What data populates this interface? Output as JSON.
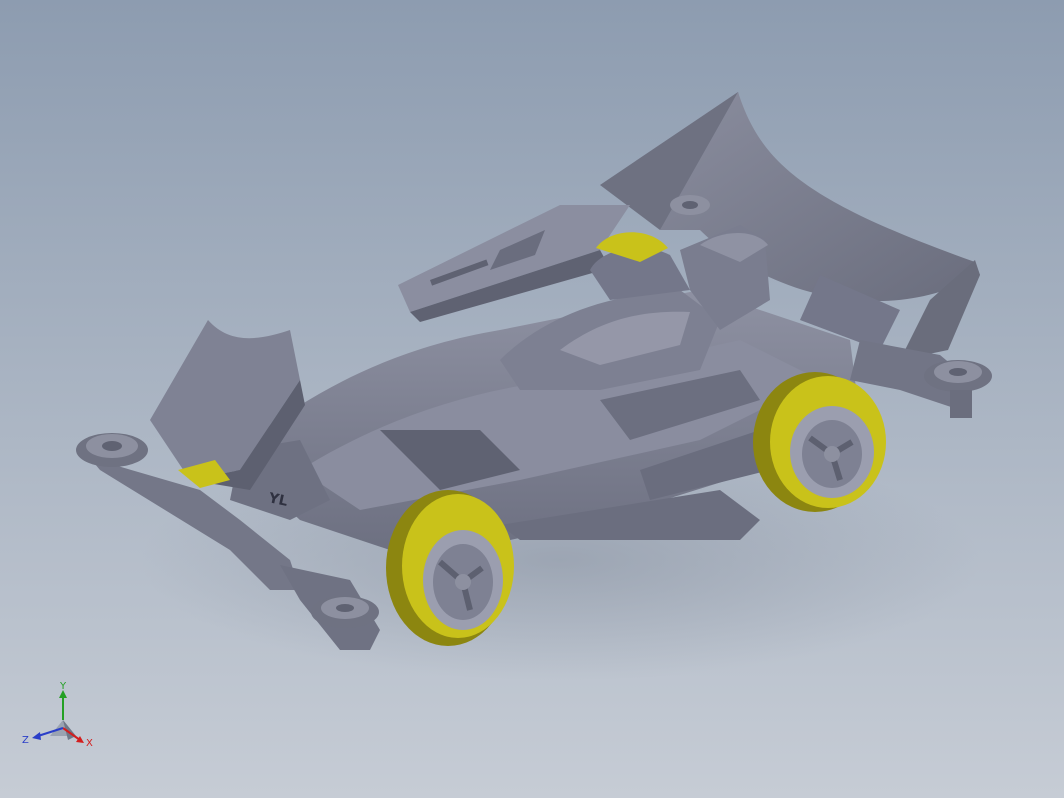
{
  "model": {
    "part_marking": "YL"
  },
  "triad": {
    "x_label": "X",
    "y_label": "Y",
    "z_label": "Z"
  },
  "colors": {
    "background_top": "#8d9cb0",
    "background_bottom": "#c6ccd5",
    "body": "#7c7f90",
    "body_light": "#9a9dad",
    "body_dark": "#5c5f6e",
    "tire": "#c9c21a",
    "tire_dark": "#8c8610",
    "axis_x": "#d21e1e",
    "axis_y": "#24a024",
    "axis_z": "#2a3ec8"
  }
}
